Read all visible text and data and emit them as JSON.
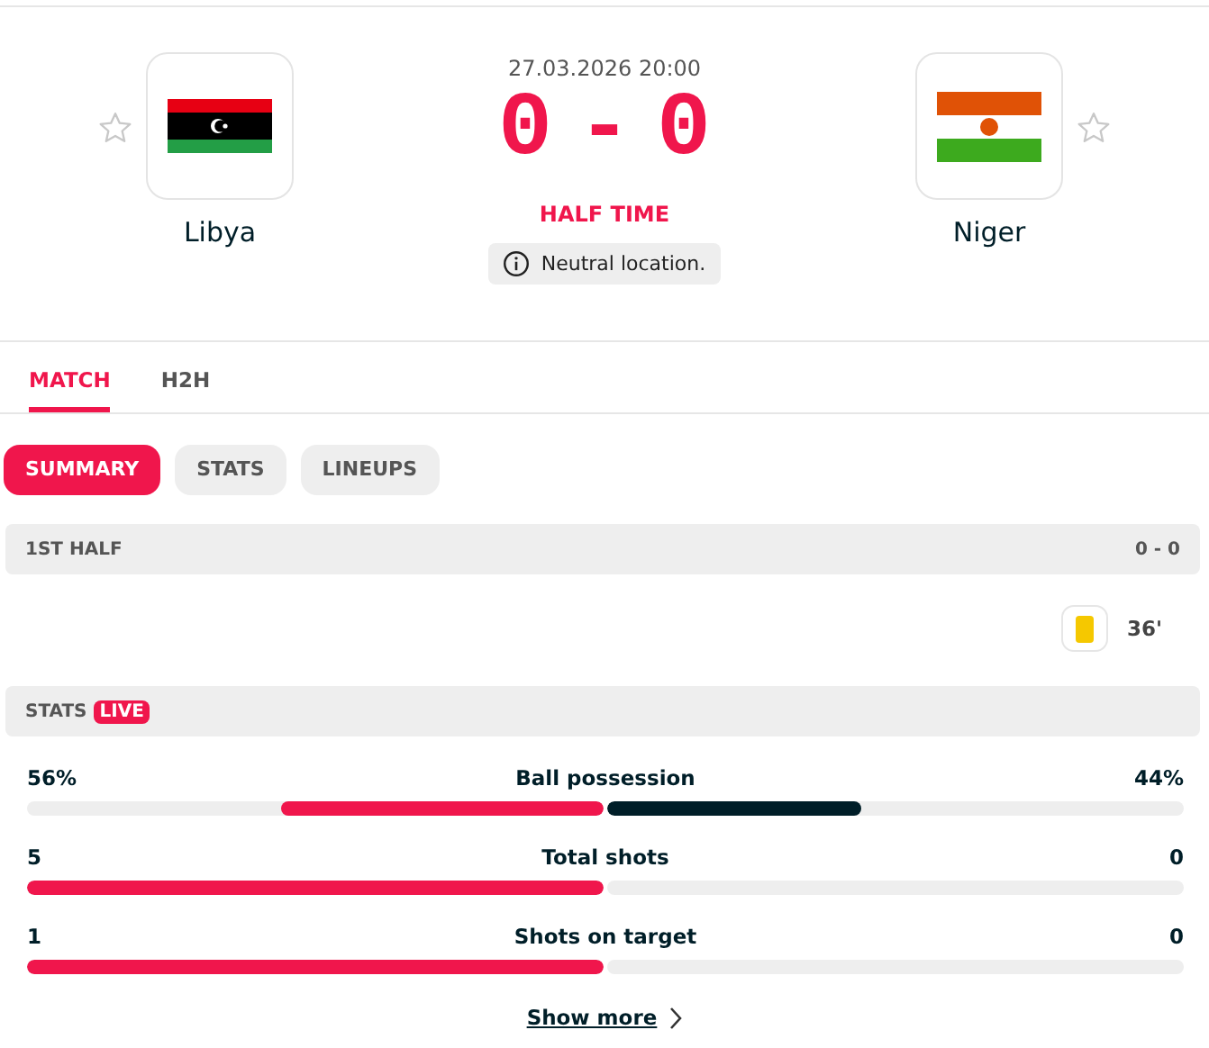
{
  "match": {
    "date_time": "27.03.2026 20:00",
    "status": "HALF TIME",
    "venue_note": "Neutral location.",
    "home": {
      "name": "Libya",
      "favorite": false,
      "score": "0"
    },
    "away": {
      "name": "Niger",
      "favorite": false,
      "score": "0"
    },
    "score_separator": "-"
  },
  "tabs": [
    {
      "label": "MATCH",
      "selected": true
    },
    {
      "label": "H2H",
      "selected": false
    }
  ],
  "subtabs": [
    {
      "label": "SUMMARY",
      "selected": true
    },
    {
      "label": "STATS",
      "selected": false
    },
    {
      "label": "LINEUPS",
      "selected": false
    }
  ],
  "first_half": {
    "title": "1ST HALF",
    "score": "0 - 0",
    "away_incidents": [
      {
        "kind": "yellow-card",
        "minute": "36'"
      }
    ]
  },
  "stats": {
    "title": "STATS",
    "badge": "LIVE",
    "rows": [
      {
        "name": "Ball possession",
        "home": {
          "value": "56%",
          "level": 0.56
        },
        "away": {
          "value": "44%",
          "level": 0.44
        }
      },
      {
        "name": "Total shots",
        "home": {
          "value": "5",
          "level": 1
        },
        "away": {
          "value": "0",
          "level": 0
        }
      },
      {
        "name": "Shots on target",
        "home": {
          "value": "1",
          "level": 1
        },
        "away": {
          "value": "0",
          "level": 0
        }
      }
    ],
    "show_more": "Show more"
  }
}
